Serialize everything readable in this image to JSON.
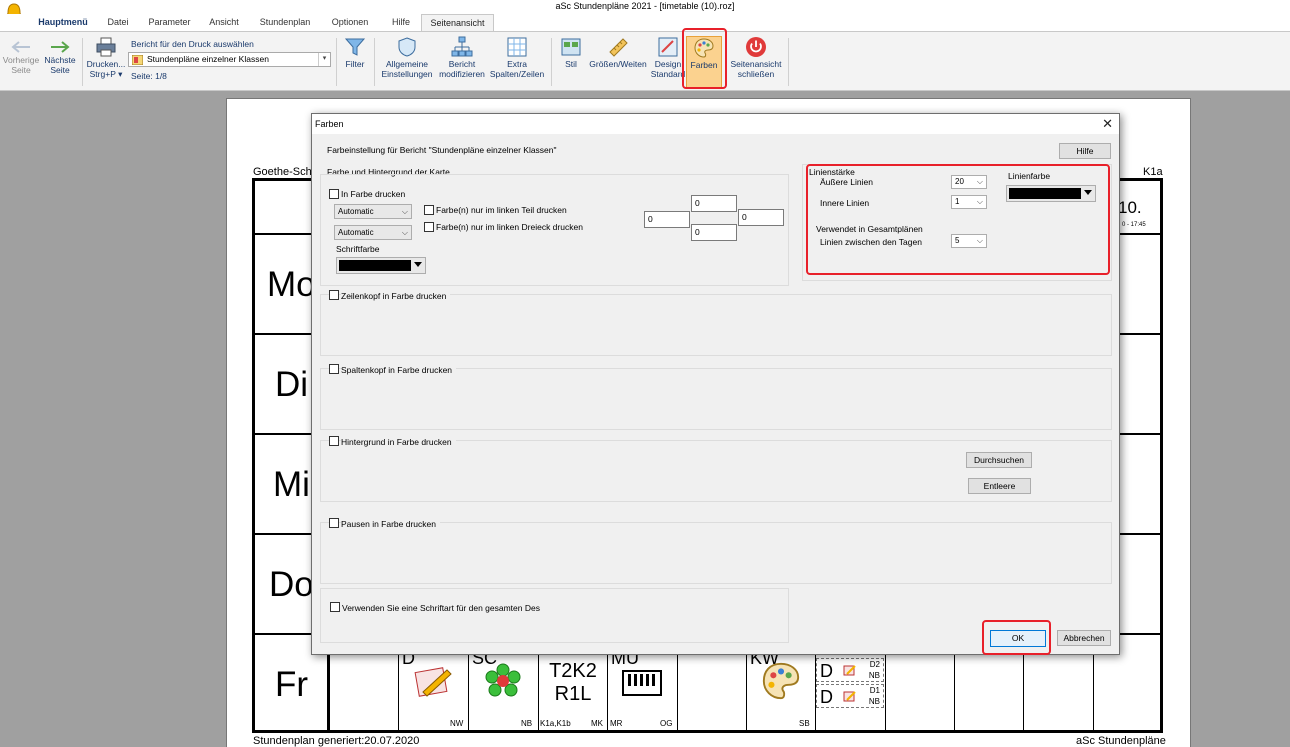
{
  "window": {
    "title": "aSc Stundenpläne 2021  - [timetable (10).roz]"
  },
  "menu": {
    "tabs": [
      {
        "label": "Hauptmenü"
      },
      {
        "label": "Datei"
      },
      {
        "label": "Parameter"
      },
      {
        "label": "Ansicht"
      },
      {
        "label": "Stundenplan"
      },
      {
        "label": "Optionen"
      },
      {
        "label": "Hilfe"
      },
      {
        "label": "Seitenansicht"
      }
    ],
    "active_tab": "Seitenansicht"
  },
  "ribbon": {
    "prev_page": {
      "line1": "Vorherige",
      "line2": "Seite"
    },
    "next_page": {
      "line1": "Nächste",
      "line2": "Seite"
    },
    "print": {
      "line1": "Drucken...",
      "line2": "Strg+P ▾"
    },
    "report_label": "Bericht für den Druck auswählen",
    "report_selected": "Stundenpläne einzelner Klassen",
    "page_info": "Seite: 1/8",
    "filter": "Filter",
    "general": {
      "line1": "Allgemeine",
      "line2": "Einstellungen"
    },
    "modify": {
      "line1": "Bericht",
      "line2": "modifizieren"
    },
    "extra": {
      "line1": "Extra",
      "line2": "Spalten/Zeilen"
    },
    "style": "Stil",
    "sizes": "Größen/Weiten",
    "design": {
      "line1": "Design",
      "line2": "Standard"
    },
    "colors": "Farben",
    "close_preview": {
      "line1": "Seitenansicht",
      "line2": "schließen"
    }
  },
  "preview": {
    "school": "Goethe-Schu",
    "class": "K1a",
    "days": [
      "Mo",
      "Di",
      "Mi",
      "Do",
      "Fr"
    ],
    "date_fragment": "10.",
    "time_fragment": "0 - 17:45",
    "footer_left": "Stundenplan generiert:20.07.2020",
    "footer_right": "aSc Stundenpläne",
    "fr_row": {
      "top_fragments": [
        "D",
        "SC",
        "MU",
        "KW"
      ],
      "lesson_big": {
        "line1": "T2K2",
        "line2": "R1L"
      },
      "teachers": [
        "NW",
        "NB",
        "MK",
        "OG",
        "SB"
      ],
      "classes_label": "K1a,K1b",
      "room_label": "MR",
      "dblocks": [
        {
          "letter": "D",
          "r1": "D2",
          "r2": "NB"
        },
        {
          "letter": "D",
          "r1": "D1",
          "r2": "NB"
        }
      ]
    }
  },
  "dialog": {
    "title": "Farben",
    "heading": "Farbeinstellung für Bericht \"Stundenpläne einzelner Klassen\"",
    "help_button": "Hilfe",
    "card_section": {
      "label": "Farbe und Hintergrund der Karte",
      "print_in_color": "In Farbe drucken",
      "combo1": "Automatic",
      "combo2": "Automatic",
      "left_part": "Farbe(n) nur im linken Teil drucken",
      "left_triangle": "Farbe(n) nur im linken Dreieck drucken",
      "font_color_label": "Schriftfarbe",
      "margin_top": "0",
      "margin_left": "0",
      "margin_right": "0",
      "margin_bottom": "0"
    },
    "line_section": {
      "line_strength": "Linienstärke",
      "outer_lines_label": "Äußere Linien",
      "outer_lines_value": "20",
      "inner_lines_label": "Innere Linien",
      "inner_lines_value": "1",
      "used_in_overall": "Verwendet in Gesamtplänen",
      "between_days_label": "Linien zwischen den Tagen",
      "between_days_value": "5",
      "line_color_label": "Linienfarbe"
    },
    "row_header": "Zeilenkopf in Farbe drucken",
    "col_header": "Spaltenkopf in Farbe drucken",
    "background": "Hintergrund in Farbe drucken",
    "browse_button": "Durchsuchen",
    "clear_button": "Entleere",
    "breaks": "Pausen in Farbe drucken",
    "one_font": "Verwenden Sie eine Schriftart für den gesamten Des",
    "ok_button": "OK",
    "cancel_button": "Abbrechen"
  },
  "colors": {
    "highlight": "#e8202a",
    "ribbon_text": "#1a3a6c",
    "font_color": "#000000",
    "line_color": "#000000"
  }
}
